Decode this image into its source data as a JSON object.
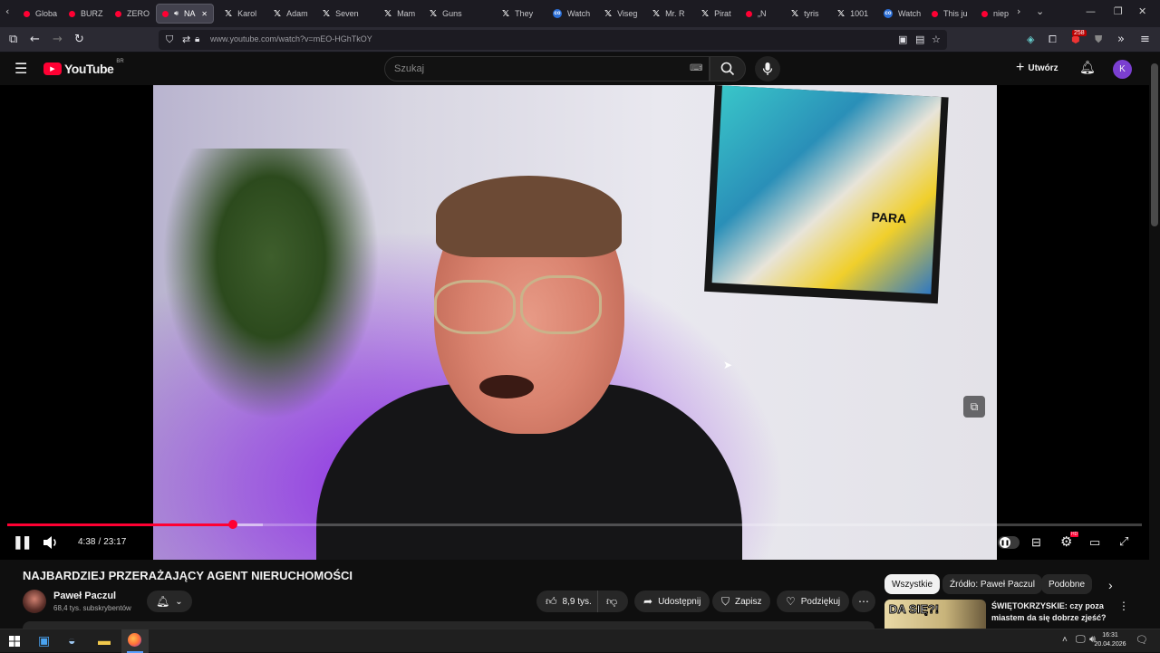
{
  "browser": {
    "tabs": [
      {
        "label": "Globa",
        "icon": "youtube-icon"
      },
      {
        "label": "BURZ",
        "icon": "youtube-icon"
      },
      {
        "label": "ZERO",
        "icon": "youtube-icon"
      },
      {
        "label": "NA",
        "icon": "youtube-icon",
        "active": true
      },
      {
        "label": "Karol",
        "icon": "x-icon"
      },
      {
        "label": "Adam",
        "icon": "x-icon"
      },
      {
        "label": "Seven",
        "icon": "x-icon"
      },
      {
        "label": "Mam",
        "icon": "x-icon"
      },
      {
        "label": "Guns",
        "icon": "x-icon"
      },
      {
        "label": "They",
        "icon": "x-icon"
      },
      {
        "label": "Watch",
        "icon": "copilot-icon"
      },
      {
        "label": "Viseg",
        "icon": "x-icon"
      },
      {
        "label": "Mr. R",
        "icon": "x-icon"
      },
      {
        "label": "Pirat",
        "icon": "x-icon"
      },
      {
        "label": "„N",
        "icon": "youtube-icon"
      },
      {
        "label": "tyris",
        "icon": "x-icon"
      },
      {
        "label": "1001",
        "icon": "x-icon"
      },
      {
        "label": "Watch",
        "icon": "copilot-icon"
      },
      {
        "label": "This ju",
        "icon": "youtube-icon"
      },
      {
        "label": "niep",
        "icon": "youtube-icon"
      }
    ],
    "url": "www.youtube.com/watch?v=mEO-HGhTkOY",
    "extension_badge": "258"
  },
  "youtube": {
    "logo_text": "YouTube",
    "logo_region": "BR",
    "search_placeholder": "Szukaj",
    "create_label": "Utwórz",
    "avatar_letter": "K",
    "accent": "#ff0033"
  },
  "player": {
    "time_current": "4:38",
    "time_sep": "/",
    "time_total": "23:17",
    "progress": 0.199,
    "buffered": 0.225
  },
  "video": {
    "title": "NAJBARDZIEJ PRZERAŻAJĄCY AGENT NIERUCHOMOŚCI",
    "channel_name": "Paweł Paczul",
    "subscribers": "68,4 tys. subskrybentów",
    "likes": "8,9 tys.",
    "share_label": "Udostępnij",
    "save_label": "Zapisz",
    "thanks_label": "Podziękuj",
    "painting_text": "PARA"
  },
  "sidebar": {
    "chips": [
      "Wszystkie",
      "Źródło: Paweł Paczul",
      "Podobne"
    ],
    "rec_title": "ŚWIĘTOKRZYSKIE: czy poza miastem da się dobrze zjeść?",
    "rec_thumb_text": "DA SIĘ?!"
  },
  "taskbar": {
    "time": "16:31",
    "date": "20.04.2026"
  }
}
